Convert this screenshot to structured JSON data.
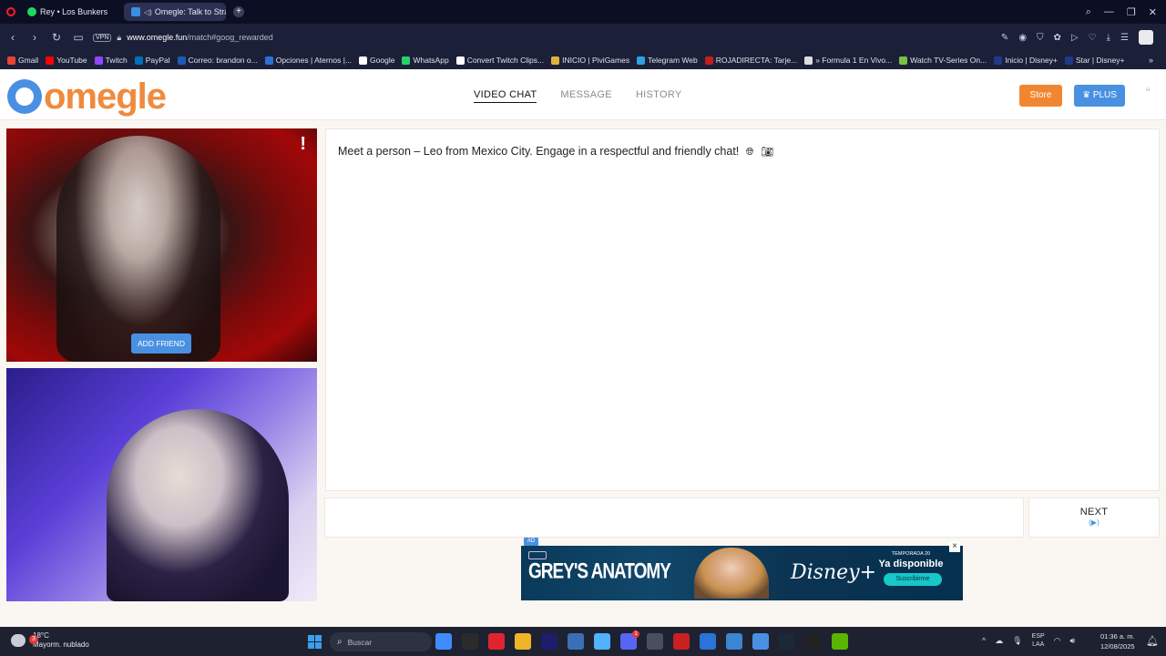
{
  "browser": {
    "tabs": [
      {
        "title": "Rey • Los Bunkers"
      },
      {
        "title": "Omegle: Talk to Stran"
      }
    ],
    "url_host": "www.omegle.fun",
    "url_path": "/match#goog_rewarded",
    "vpn_label": "VPN",
    "bookmarks": [
      {
        "label": "Gmail",
        "color": "#ea4335"
      },
      {
        "label": "YouTube",
        "color": "#ff0000"
      },
      {
        "label": "Twitch",
        "color": "#9146ff"
      },
      {
        "label": "PayPal",
        "color": "#0070ba"
      },
      {
        "label": "Correo: brandon o...",
        "color": "#1e5ab4"
      },
      {
        "label": "Opciones | Aternos |...",
        "color": "#2f6fd1"
      },
      {
        "label": "Google",
        "color": "#ffffff"
      },
      {
        "label": "WhatsApp",
        "color": "#25d366"
      },
      {
        "label": "Convert Twitch Clips...",
        "color": "#ffffff"
      },
      {
        "label": "INICIO | PiviGames",
        "color": "#e2b13c"
      },
      {
        "label": "Telegram Web",
        "color": "#2aa3e0"
      },
      {
        "label": "ROJADIRECTA: Tarje...",
        "color": "#c41f1f"
      },
      {
        "label": "» Formula 1 En Vivo...",
        "color": "#dddddd"
      },
      {
        "label": "Watch TV-Series On...",
        "color": "#7bc043"
      },
      {
        "label": "Inicio | Disney+",
        "color": "#1e3a8a"
      },
      {
        "label": "Star | Disney+",
        "color": "#1e3a8a"
      }
    ]
  },
  "site": {
    "logo_text": "omegle",
    "nav": {
      "video_chat": "VIDEO CHAT",
      "message": "MESSAGE",
      "history": "HISTORY"
    },
    "store_label": "Store",
    "plus_label": "PLUS",
    "add_friend_label": "ADD FRIEND",
    "report_label": "!",
    "chat_message": "Meet a person – Leo from Mexico City. Engage in a respectful and friendly chat!",
    "next_label": "NEXT",
    "ad_tag": "AD",
    "ad": {
      "show_title": "GREY'S ANATOMY",
      "brand": "Disney+",
      "season": "TEMPORADA 20",
      "availability": "Ya disponible",
      "cta": "Suscribirme"
    }
  },
  "taskbar": {
    "weather_temp": "18°C",
    "weather_desc": "Mayorm. nublado",
    "weather_badge": "3",
    "search_placeholder": "Buscar",
    "discord_badge": "1",
    "lang_top": "ESP",
    "lang_bottom": "LAA",
    "time": "01:36 a. m.",
    "date": "12/08/2025",
    "apps": [
      {
        "name": "widgets",
        "color": "#3f8cff"
      },
      {
        "name": "file-explorer",
        "color": "#2b2b2b"
      },
      {
        "name": "opera",
        "color": "#e0242f"
      },
      {
        "name": "folder",
        "color": "#f0b429"
      },
      {
        "name": "premiere",
        "color": "#1d1d6b"
      },
      {
        "name": "visual-studio",
        "color": "#3b6fb5"
      },
      {
        "name": "copilot",
        "color": "#4fb3ff"
      },
      {
        "name": "discord",
        "color": "#5865f2"
      },
      {
        "name": "settings",
        "color": "#4a4f60"
      },
      {
        "name": "browser",
        "color": "#c92020"
      },
      {
        "name": "store",
        "color": "#2a73d8"
      },
      {
        "name": "snipping",
        "color": "#3a86d1"
      },
      {
        "name": "photos",
        "color": "#4a90e2"
      },
      {
        "name": "steam",
        "color": "#1b2838"
      },
      {
        "name": "epic-games",
        "color": "#222222"
      },
      {
        "name": "nvidia",
        "color": "#5ab500"
      }
    ]
  }
}
